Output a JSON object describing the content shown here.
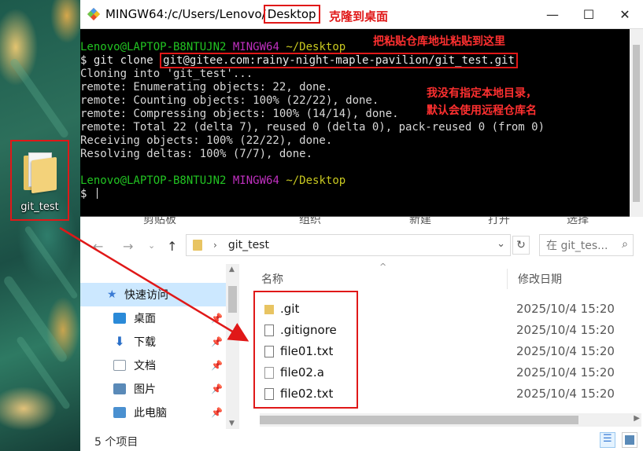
{
  "terminal": {
    "title_prefix": "MINGW64:/c/Users/Lenovo/",
    "title_highlight": "Desktop",
    "title_annotation": "克隆到桌面",
    "controls": {
      "minimize": "—",
      "maximize": "☐",
      "close": "✕"
    },
    "prompt": {
      "user_host": "Lenovo@LAPTOP-B8NTUJN2",
      "shell": "MINGW64",
      "path": "~/Desktop"
    },
    "command_prefix": "$ git clone ",
    "command_url": "git@gitee.com:rainy-night-maple-pavilion/git_test.git",
    "output_lines": [
      "Cloning into 'git_test'...",
      "remote: Enumerating objects: 22, done.",
      "remote: Counting objects: 100% (22/22), done.",
      "remote: Compressing objects: 100% (14/14), done.",
      "remote: Total 22 (delta 7), reused 0 (delta 0), pack-reused 0 (from 0)",
      "Receiving objects: 100% (22/22), done.",
      "Resolving deltas: 100% (7/7), done."
    ],
    "final_prompt": "$ ",
    "annotation_paste": "把粘贴仓库地址粘贴到这里",
    "annotation_dir_line1": "我没有指定本地目录，",
    "annotation_dir_line2": "默认会使用远程仓库名"
  },
  "desktop": {
    "folder_label": "git_test"
  },
  "explorer": {
    "ribbon_labels": [
      "剪贴板",
      "组织",
      "新建",
      "打开",
      "选择"
    ],
    "address_path": "git_test",
    "search_placeholder": "在 git_tes...",
    "nav_items": [
      {
        "label": "快速访问",
        "icon_color": "#3a7bd5",
        "pinned": false
      },
      {
        "label": "桌面",
        "icon_color": "#2a8ad8",
        "pinned": true
      },
      {
        "label": "下载",
        "icon_color": "#2a6fc8",
        "pinned": true
      },
      {
        "label": "文档",
        "icon_color": "#8c9aa8",
        "pinned": true
      },
      {
        "label": "图片",
        "icon_color": "#5a8ab8",
        "pinned": true
      },
      {
        "label": "此电脑",
        "icon_color": "#4a90d0",
        "pinned": true
      }
    ],
    "columns": {
      "name": "名称",
      "modified": "修改日期"
    },
    "files": [
      {
        "name": ".git",
        "type": "folder",
        "modified": "2025/10/4 15:20"
      },
      {
        "name": ".gitignore",
        "type": "text",
        "modified": "2025/10/4 15:20"
      },
      {
        "name": "file01.txt",
        "type": "text",
        "modified": "2025/10/4 15:20"
      },
      {
        "name": "file02.a",
        "type": "blank",
        "modified": "2025/10/4 15:20"
      },
      {
        "name": "file02.txt",
        "type": "text",
        "modified": "2025/10/4 15:20"
      }
    ],
    "status_count": "5 个项目"
  },
  "colors": {
    "annotation_red": "#e01818",
    "prompt_green": "#22c422",
    "prompt_magenta": "#c030c0",
    "prompt_yellow": "#c9c920",
    "selected_nav": "#cce8ff"
  }
}
